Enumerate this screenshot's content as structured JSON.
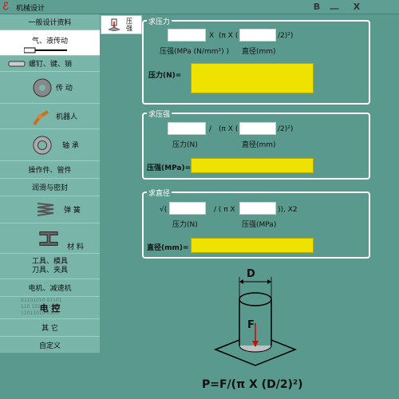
{
  "window": {
    "title": "机械设计",
    "btn_b": "B",
    "btn_min": "__",
    "btn_close": "X"
  },
  "sidebar": {
    "items": [
      {
        "label": "一般设计资料"
      },
      {
        "label": "气、液传动"
      },
      {
        "label": "螺钉、键、销"
      },
      {
        "label": "传 动"
      },
      {
        "label": "机器人"
      },
      {
        "label": "轴 承"
      },
      {
        "label": "操作件、管件"
      },
      {
        "label": "润滑与密封"
      },
      {
        "label": "弹 簧"
      },
      {
        "label": "材 料"
      },
      {
        "label": "工具、模具\n刀具、夹具"
      },
      {
        "label": "电机、减速机"
      },
      {
        "label": "电 控",
        "bg_digits": "01101010 01101\n110 10101 10\n11011010 0101"
      },
      {
        "label": "其 它"
      },
      {
        "label": "自定义"
      }
    ]
  },
  "subtab": {
    "label": "压\n强"
  },
  "force": {
    "title": "求压力",
    "times": "X",
    "pi_open": "(π  X (",
    "tail": "/2)²)",
    "pressure_label": "压强(MPa (N/mm²) )",
    "diameter_label": "直径(mm)",
    "result_label": "压力(N)="
  },
  "pressure": {
    "title": "求压强",
    "divide": "/",
    "pi_open": "(π  X (",
    "tail": "/2)²)",
    "force_label": "压力(N)",
    "diameter_label": "直径(mm)",
    "result_label": "压强(MPa)="
  },
  "diameter": {
    "title": "求直径",
    "sqrt_open": "√(",
    "divide_open": "/ ( π X",
    "tail": ")),   X2",
    "force_label": "压力(N)",
    "pressure_label": "压强(MPa)",
    "result_label": "直径(mm)="
  },
  "figure": {
    "d_label": "D",
    "f_label": "F",
    "formula": "P=F/(π X (D/2)²)"
  },
  "colors": {
    "background": "#5a9a8e",
    "result_fill": "#f0e200",
    "group_border": "#ffffff"
  }
}
